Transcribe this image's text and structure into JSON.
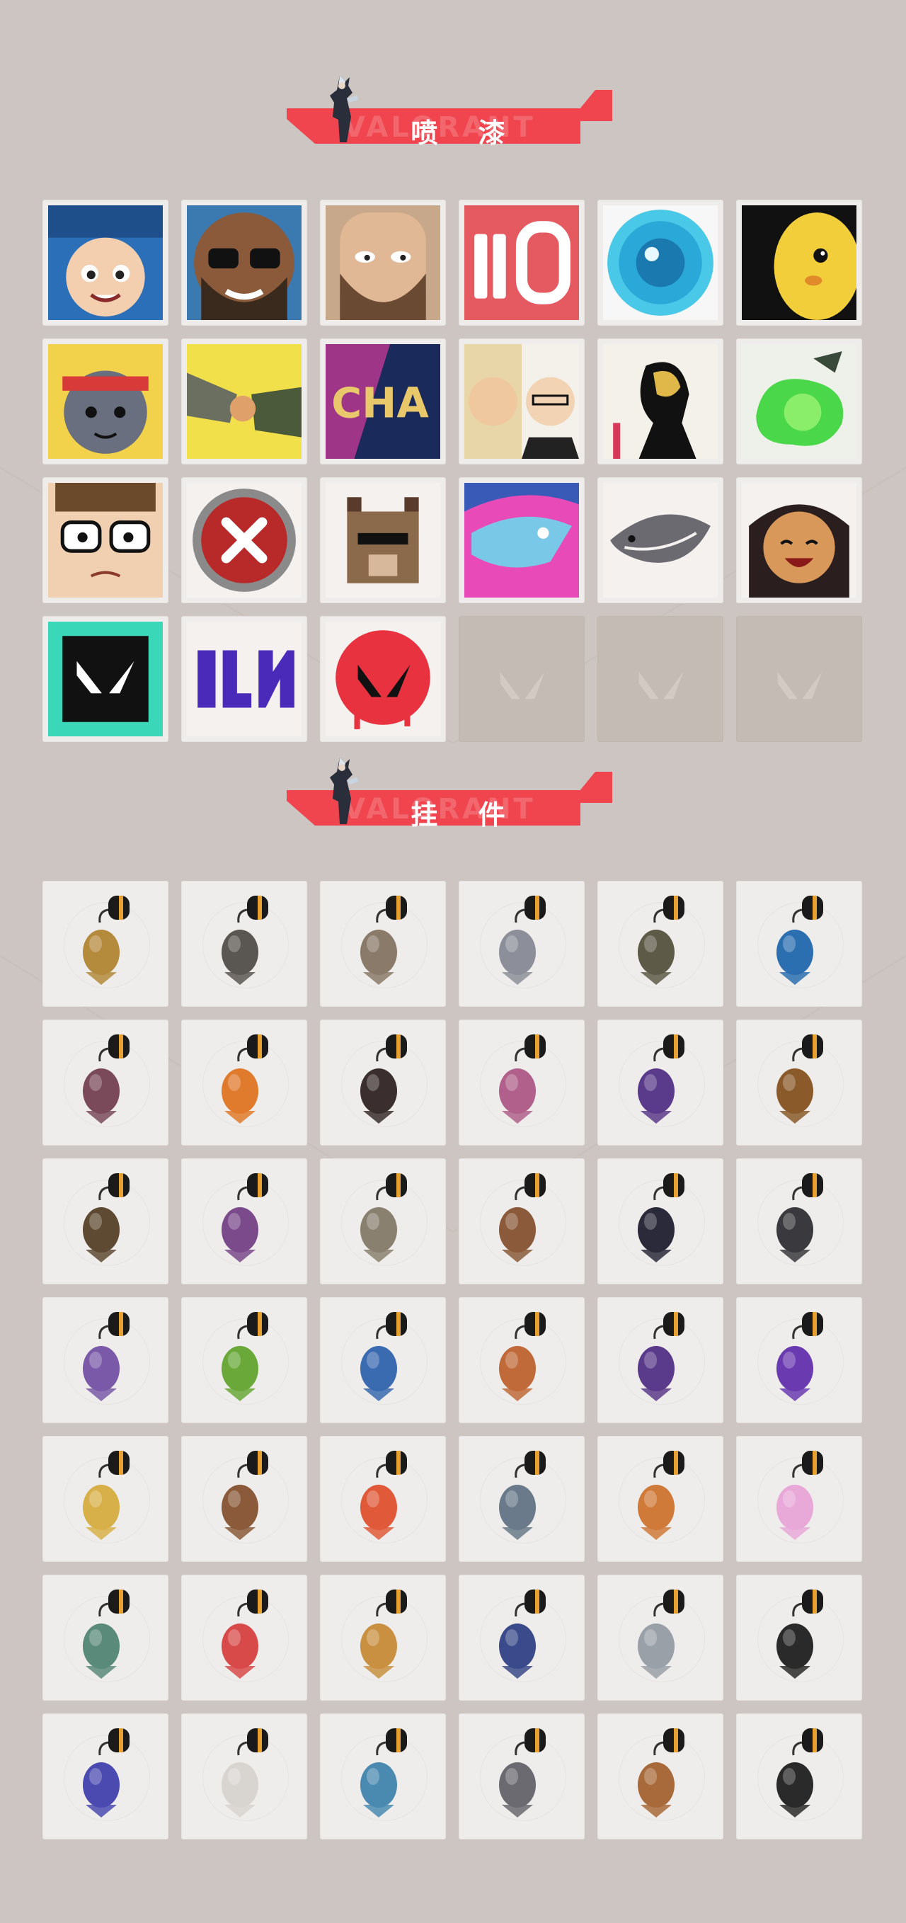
{
  "sections": {
    "sprays": {
      "title": "喷 漆",
      "ghost_text": "VALORANT"
    },
    "charms": {
      "title": "挂 件",
      "ghost_text": "VALORANT"
    }
  },
  "colors": {
    "page_bg": "#cdc5c1",
    "banner": "#f0454f",
    "tile_bg": "#efedeb",
    "empty_tile": "#c4bbb4"
  },
  "sprays": [
    {
      "icon": "blue-beanie-girl-spray-icon"
    },
    {
      "icon": "sunglasses-bearded-man-spray-icon"
    },
    {
      "icon": "smug-bearded-man-spray-icon"
    },
    {
      "icon": "ammo-ten-spray-icon"
    },
    {
      "icon": "blue-eye-orb-spray-icon"
    },
    {
      "icon": "yellow-chick-spray-icon"
    },
    {
      "icon": "headband-mouse-spray-icon"
    },
    {
      "icon": "fist-bump-spray-icon"
    },
    {
      "icon": "champions-logo-spray-icon"
    },
    {
      "icon": "split-faces-spray-icon"
    },
    {
      "icon": "gold-mask-silhouette-spray-icon"
    },
    {
      "icon": "green-slime-spray-icon"
    },
    {
      "icon": "glasses-nervous-man-spray-icon"
    },
    {
      "icon": "red-x-button-spray-icon"
    },
    {
      "icon": "pixel-bear-spray-icon"
    },
    {
      "icon": "pink-shark-spray-icon"
    },
    {
      "icon": "catfish-spray-icon"
    },
    {
      "icon": "laughing-woman-spray-icon"
    },
    {
      "icon": "valorant-logo-splatter-spray-icon"
    },
    {
      "icon": "purple-graffiti-spray-icon"
    },
    {
      "icon": "red-valorant-drip-spray-icon"
    },
    {
      "icon": "empty-slot-icon",
      "empty": true
    },
    {
      "icon": "empty-slot-icon",
      "empty": true
    },
    {
      "icon": "empty-slot-icon",
      "empty": true
    }
  ],
  "charms": [
    {
      "icon": "golden-bear-charm-icon",
      "color": "#b48a3c"
    },
    {
      "icon": "drone-bot-charm-icon",
      "color": "#5a5651"
    },
    {
      "icon": "cake-box-charm-icon",
      "color": "#8a7a6a"
    },
    {
      "icon": "raccoon-charm-icon",
      "color": "#8c8f99"
    },
    {
      "icon": "round-bag-charm-icon",
      "color": "#5e5a48"
    },
    {
      "icon": "battery-cell-charm-icon",
      "color": "#2c6fb0"
    },
    {
      "icon": "spiked-bat-charm-icon",
      "color": "#7a4a5a"
    },
    {
      "icon": "chili-pepper-charm-icon",
      "color": "#e07a2c"
    },
    {
      "icon": "braided-cord-charm-icon",
      "color": "#3a2e2e"
    },
    {
      "icon": "cupcake-charm-icon",
      "color": "#b0608a"
    },
    {
      "icon": "ep9-medallion-charm-icon",
      "color": "#5a3a8a"
    },
    {
      "icon": "boxer-toy-charm-icon",
      "color": "#8a5a2a"
    },
    {
      "icon": "camera-rig-charm-icon",
      "color": "#5e4a32"
    },
    {
      "icon": "agent-girl-charm-icon",
      "color": "#7a4a8a"
    },
    {
      "icon": "cowboy-robot-charm-icon",
      "color": "#8a8070"
    },
    {
      "icon": "hanging-crate-charm-icon",
      "color": "#8a5a3a"
    },
    {
      "icon": "jester-figure-charm-icon",
      "color": "#2a2a3a"
    },
    {
      "icon": "claw-hook-charm-icon",
      "color": "#3a3a3e"
    },
    {
      "icon": "lava-lamp-charm-icon",
      "color": "#7a5aa8"
    },
    {
      "icon": "pager-charm-icon",
      "color": "#6aa83a"
    },
    {
      "icon": "astronaut-charm-icon",
      "color": "#3a6ab0"
    },
    {
      "icon": "radio-device-charm-icon",
      "color": "#c06a3a"
    },
    {
      "icon": "ep9-medallion-charm-icon",
      "color": "#5a3a8a"
    },
    {
      "icon": "pixel-heart-charm-icon",
      "color": "#6a3ab0"
    },
    {
      "icon": "taco-critter-charm-icon",
      "color": "#d8b04a"
    },
    {
      "icon": "ice-pop-charm-icon",
      "color": "#8a5a3a"
    },
    {
      "icon": "dango-skewer-charm-icon",
      "color": "#e05a3a"
    },
    {
      "icon": "agent-card-charm-icon",
      "color": "#6a7a8a"
    },
    {
      "icon": "hot-air-balloon-charm-icon",
      "color": "#d07a3a"
    },
    {
      "icon": "pink-bunny-charm-icon",
      "color": "#e8a8d8"
    },
    {
      "icon": "robot-box-charm-icon",
      "color": "#5a8a7a"
    },
    {
      "icon": "watermelon-slice-charm-icon",
      "color": "#d84a4a"
    },
    {
      "icon": "honey-pot-charm-icon",
      "color": "#c89040"
    },
    {
      "icon": "ep9-medallion-charm-icon",
      "color": "#3a4a8a"
    },
    {
      "icon": "silver-wave-charm-icon",
      "color": "#9aa0a8"
    },
    {
      "icon": "black-card-charm-icon",
      "color": "#2a2a2a"
    },
    {
      "icon": "mecha-robot-charm-icon",
      "color": "#4a4ab0"
    },
    {
      "icon": "champions-badge-charm-icon",
      "color": "#d8d4d0"
    },
    {
      "icon": "ufo-charm-icon",
      "color": "#4a8ab0"
    },
    {
      "icon": "grey-cat-charm-icon",
      "color": "#6a6a70"
    },
    {
      "icon": "bronze-seal-charm-icon",
      "color": "#a86a3a"
    },
    {
      "icon": "valorant-medallion-charm-icon",
      "color": "#2a2a2a"
    }
  ]
}
